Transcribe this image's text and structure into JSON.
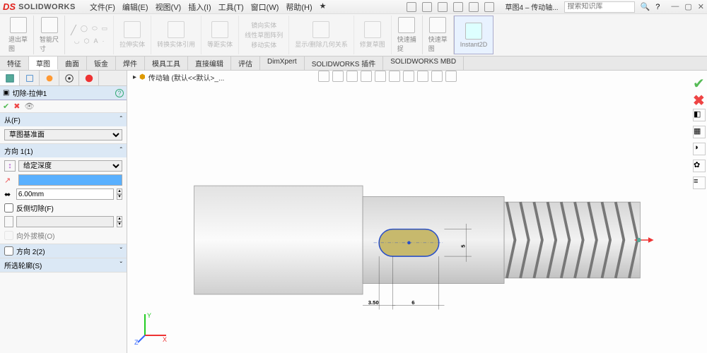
{
  "app": {
    "logo": "DS",
    "brand": "SOLIDWORKS"
  },
  "menu": {
    "file": "文件(F)",
    "edit": "编辑(E)",
    "view": "视图(V)",
    "insert": "插入(I)",
    "tools": "工具(T)",
    "window": "窗口(W)",
    "help": "帮助(H)"
  },
  "title": {
    "doc": "草图4 – 传动轴..."
  },
  "search": {
    "placeholder": "搜索知识库"
  },
  "ribbon": {
    "g1a": "退出草",
    "g1b": "图",
    "g2a": "智能尺",
    "g2b": "寸",
    "g3": "拉伸实体",
    "g4": "转换实体引用",
    "g5": "等距实体",
    "g6a": "镜向实体",
    "g6b": "线性草图阵列",
    "g6c": "移动实体",
    "g7": "显示/删除几何关系",
    "g8": "修复草图",
    "g9a": "快速捕",
    "g9b": "捉",
    "g10a": "快速草",
    "g10b": "图",
    "g11": "Instant2D"
  },
  "tabs": {
    "t1": "特征",
    "t2": "草图",
    "t3": "曲面",
    "t4": "钣金",
    "t5": "焊件",
    "t6": "模具工具",
    "t7": "直接编辑",
    "t8": "评估",
    "t9": "DimXpert",
    "t10": "SOLIDWORKS 插件",
    "t11": "SOLIDWORKS MBD"
  },
  "pm": {
    "title": "切除-拉伸1",
    "from": "从(F)",
    "from_val": "草图基准面",
    "dir1": "方向 1(1)",
    "dir1_val": "给定深度",
    "depth": "6.00mm",
    "flip": "反侧切除(F)",
    "draft": "向外拔模(O)",
    "dir2": "方向 2(2)",
    "sel": "所选轮廓(S)"
  },
  "crumb": {
    "part": "传动轴 (默认<<默认>_..."
  },
  "dims": {
    "d1": "3.50",
    "d2": "6",
    "d3": "5"
  }
}
